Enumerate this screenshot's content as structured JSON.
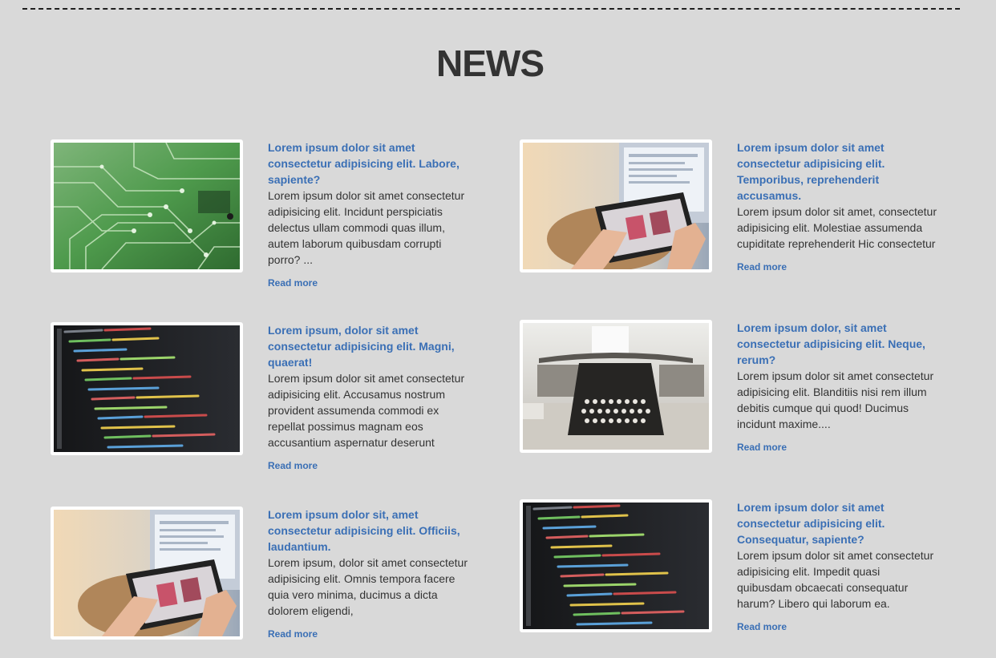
{
  "header": {
    "title": "NEWS"
  },
  "articles": [
    {
      "image": "circuit-board-photo",
      "title": "Lorem ipsum dolor sit amet consectetur adipisicing elit. Labore, sapiente?",
      "excerpt": "Lorem ipsum dolor sit amet consectetur adipisicing elit. Incidunt perspiciatis delectus ullam commodi quas illum, autem laborum quibusdam corrupti porro? ...",
      "read_more": "Read more"
    },
    {
      "image": "tablet-hands-photo",
      "title": "Lorem ipsum dolor sit amet consectetur adipisicing elit. Temporibus, reprehenderit accusamus.",
      "excerpt": "Lorem ipsum dolor sit amet, consectetur adipisicing elit. Molestiae assumenda cupiditate reprehenderit Hic consectetur",
      "read_more": "Read more"
    },
    {
      "image": "code-screen-photo",
      "title": "Lorem ipsum, dolor sit amet consectetur adipisicing elit. Magni, quaerat!",
      "excerpt": "Lorem ipsum dolor sit amet consectetur adipisicing elit. Accusamus nostrum provident assumenda commodi ex repellat possimus magnam eos accusantium aspernatur deserunt",
      "read_more": "Read more"
    },
    {
      "image": "typewriter-photo",
      "title": "Lorem ipsum dolor, sit amet consectetur adipisicing elit. Neque, rerum?",
      "excerpt": "Lorem ipsum dolor sit amet consectetur adipisicing elit. Blanditiis nisi rem illum debitis cumque qui quod! Ducimus incidunt maxime....",
      "read_more": "Read more"
    },
    {
      "image": "tablet-hands-photo",
      "title": "Lorem ipsum dolor sit, amet consectetur adipisicing elit. Officiis, laudantium.",
      "excerpt": "Lorem ipsum, dolor sit amet consectetur adipisicing elit. Omnis tempora facere quia vero minima, ducimus a dicta dolorem eligendi,",
      "read_more": "Read more"
    },
    {
      "image": "code-screen-photo",
      "title": "Lorem ipsum dolor sit amet consectetur adipisicing elit. Consequatur, sapiente?",
      "excerpt": "Lorem ipsum dolor sit amet consectetur adipisicing elit. Impedit quasi quibusdam obcaecati consequatur harum? Libero qui laborum ea.",
      "read_more": "Read more"
    }
  ],
  "colors": {
    "background": "#d9d9d9",
    "link": "#3a6fb5",
    "heading": "#333333"
  }
}
